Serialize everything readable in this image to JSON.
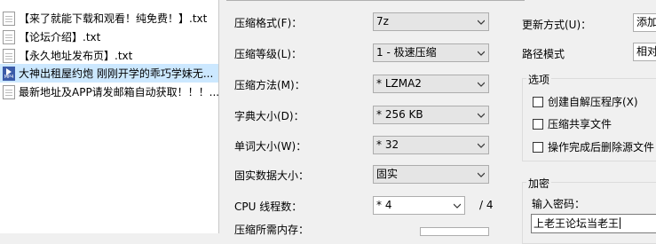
{
  "file_list": [
    {
      "name": "【来了就能下载和观看！纯免费！】.txt",
      "icon": "text-file-icon",
      "selected": false
    },
    {
      "name": "【论坛介绍】.txt",
      "icon": "text-file-icon",
      "selected": false
    },
    {
      "name": "【永久地址发布页】.txt",
      "icon": "text-file-icon",
      "selected": false
    },
    {
      "name": "大神出租屋约炮 刚刚开学的乖巧学妹无...",
      "icon": "mp4-file-icon",
      "selected": true,
      "icon_label": "MP4"
    },
    {
      "name": "最新地址及APP请发邮箱自动获取！！！...",
      "icon": "text-file-icon",
      "selected": false
    }
  ],
  "dialog": {
    "format": {
      "label": "压缩格式(F)：",
      "value": "7z"
    },
    "level": {
      "label": "压缩等级(L)：",
      "value": "1 - 极速压缩"
    },
    "method": {
      "label": "压缩方法(M)：",
      "value": "* LZMA2"
    },
    "dict": {
      "label": "字典大小(D)：",
      "value": "* 256 KB"
    },
    "word": {
      "label": "单词大小(W)：",
      "value": "* 32"
    },
    "solid": {
      "label": "固实数据大小：",
      "value": "固实"
    },
    "cpu": {
      "label": "CPU 线程数：",
      "value": "* 4",
      "max": "/ 4"
    },
    "memory": {
      "label": "压缩所需内存："
    },
    "update_mode": {
      "label": "更新方式(U)：",
      "value": "添加"
    },
    "path_mode": {
      "label": "路径模式",
      "value": "相对"
    },
    "options": {
      "title": "选项",
      "items": [
        {
          "label": "创建自解压程序(X)",
          "checked": false
        },
        {
          "label": "压缩共享文件",
          "checked": false
        },
        {
          "label": "操作完成后删除源文件",
          "checked": false
        }
      ]
    },
    "encryption": {
      "title": "加密",
      "password_label": "输入密码：",
      "password_value": "上老王论坛当老王"
    }
  }
}
